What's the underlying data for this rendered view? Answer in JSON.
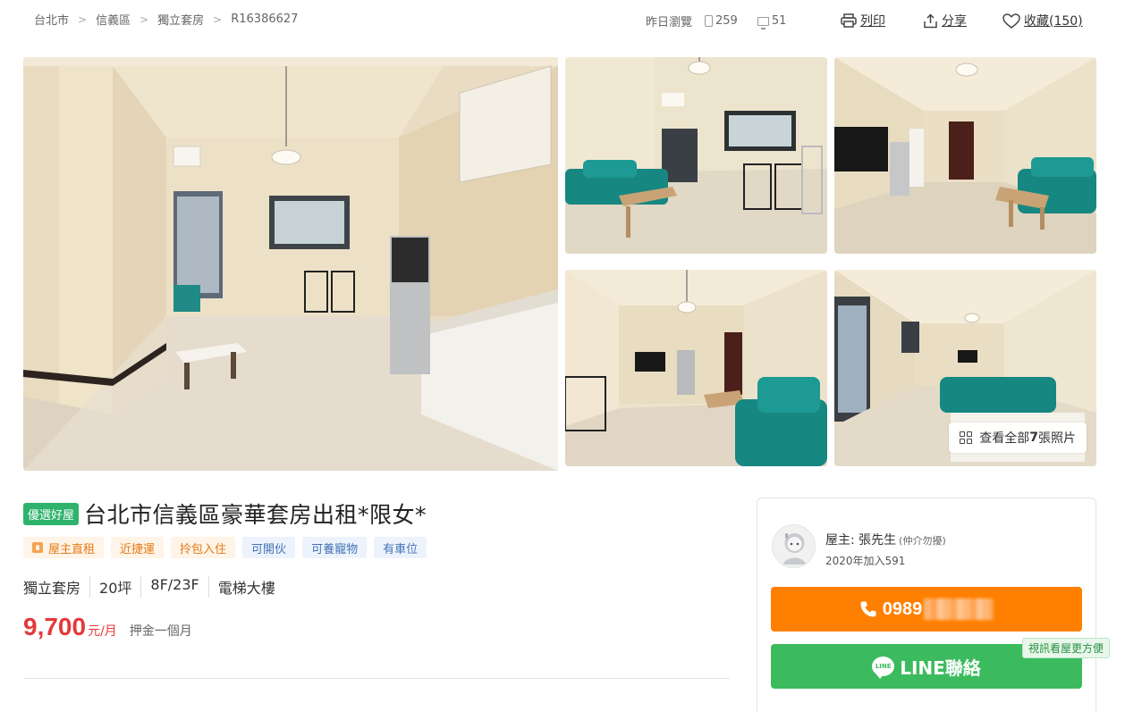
{
  "breadcrumb": [
    "台北市",
    "信義區",
    "獨立套房",
    "R16386627"
  ],
  "stats": {
    "label": "昨日瀏覽",
    "views": "259",
    "messages": "51"
  },
  "actions": {
    "print": "列印",
    "share": "分享",
    "favorite": "收藏(150)"
  },
  "gallery": {
    "view_all": "查看全部",
    "count": "7",
    "suffix": "張照片"
  },
  "listing": {
    "badge": "優選好屋",
    "title": "台北市信義區豪華套房出租*限女*",
    "tags": [
      {
        "label": "屋主直租",
        "style": "orange",
        "icon": "owner-icon"
      },
      {
        "label": "近捷運",
        "style": "orange"
      },
      {
        "label": "拎包入住",
        "style": "orange"
      },
      {
        "label": "可開伙",
        "style": "blue"
      },
      {
        "label": "可養寵物",
        "style": "blue"
      },
      {
        "label": "有車位",
        "style": "blue"
      }
    ],
    "specs": [
      "獨立套房",
      "20坪",
      "8F/23F",
      "電梯大樓"
    ],
    "price": "9,700",
    "price_unit": "元/月",
    "deposit": "押金一個月"
  },
  "contact": {
    "owner_label": "屋主: 張先生",
    "owner_note": "(仲介勿擾)",
    "joined": "2020年加入591",
    "phone_visible": "0989",
    "line_button": "LINE聯絡",
    "line_icon_text": "LINE",
    "video_tip": "視訊看屋更方便"
  },
  "colors": {
    "price": "#e4393c",
    "phone_button": "#ff8000",
    "line_button": "#3cbb5e",
    "best_badge": "#2fb36c"
  }
}
